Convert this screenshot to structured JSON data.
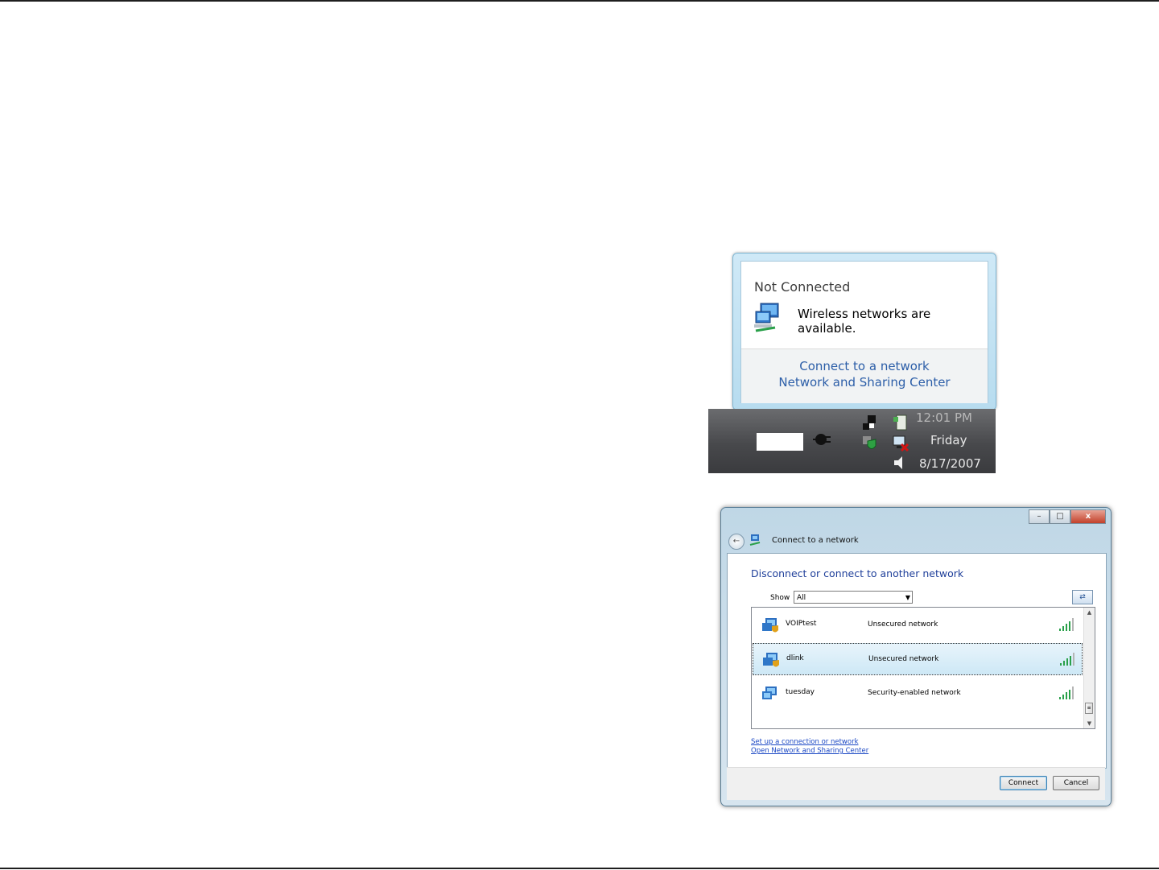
{
  "balloon": {
    "title": "Not Connected",
    "message": "Wireless networks are available.",
    "links": [
      "Connect to a network",
      "Network and Sharing Center"
    ]
  },
  "taskbar": {
    "time": "12:01 PM",
    "day": "Friday",
    "date": "8/17/2007"
  },
  "window": {
    "title": "Connect to a network",
    "caption_buttons": [
      "–",
      "□",
      "x"
    ],
    "heading": "Disconnect or connect to another network",
    "show_label": "Show",
    "show_value": "All",
    "networks": [
      {
        "name": "VOIPtest",
        "security": "Unsecured network",
        "selected": false
      },
      {
        "name": "dlink",
        "security": "Unsecured network",
        "selected": true
      },
      {
        "name": "tuesday",
        "security": "Security-enabled network",
        "selected": false
      }
    ],
    "links": [
      "Set up a connection or network",
      "Open Network and Sharing Center"
    ],
    "buttons": {
      "connect": "Connect",
      "cancel": "Cancel"
    }
  },
  "colors": {
    "link": "#1a47c4",
    "heading": "#1f3f9a",
    "taskbar": "#48494c"
  }
}
